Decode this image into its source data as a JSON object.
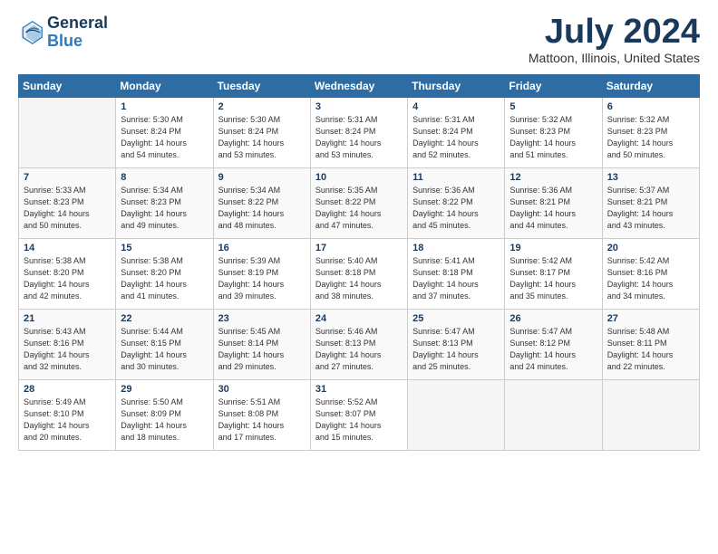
{
  "logo": {
    "line1": "General",
    "line2": "Blue"
  },
  "title": "July 2024",
  "location": "Mattoon, Illinois, United States",
  "days_of_week": [
    "Sunday",
    "Monday",
    "Tuesday",
    "Wednesday",
    "Thursday",
    "Friday",
    "Saturday"
  ],
  "weeks": [
    [
      {
        "num": "",
        "info": ""
      },
      {
        "num": "1",
        "info": "Sunrise: 5:30 AM\nSunset: 8:24 PM\nDaylight: 14 hours\nand 54 minutes."
      },
      {
        "num": "2",
        "info": "Sunrise: 5:30 AM\nSunset: 8:24 PM\nDaylight: 14 hours\nand 53 minutes."
      },
      {
        "num": "3",
        "info": "Sunrise: 5:31 AM\nSunset: 8:24 PM\nDaylight: 14 hours\nand 53 minutes."
      },
      {
        "num": "4",
        "info": "Sunrise: 5:31 AM\nSunset: 8:24 PM\nDaylight: 14 hours\nand 52 minutes."
      },
      {
        "num": "5",
        "info": "Sunrise: 5:32 AM\nSunset: 8:23 PM\nDaylight: 14 hours\nand 51 minutes."
      },
      {
        "num": "6",
        "info": "Sunrise: 5:32 AM\nSunset: 8:23 PM\nDaylight: 14 hours\nand 50 minutes."
      }
    ],
    [
      {
        "num": "7",
        "info": "Sunrise: 5:33 AM\nSunset: 8:23 PM\nDaylight: 14 hours\nand 50 minutes."
      },
      {
        "num": "8",
        "info": "Sunrise: 5:34 AM\nSunset: 8:23 PM\nDaylight: 14 hours\nand 49 minutes."
      },
      {
        "num": "9",
        "info": "Sunrise: 5:34 AM\nSunset: 8:22 PM\nDaylight: 14 hours\nand 48 minutes."
      },
      {
        "num": "10",
        "info": "Sunrise: 5:35 AM\nSunset: 8:22 PM\nDaylight: 14 hours\nand 47 minutes."
      },
      {
        "num": "11",
        "info": "Sunrise: 5:36 AM\nSunset: 8:22 PM\nDaylight: 14 hours\nand 45 minutes."
      },
      {
        "num": "12",
        "info": "Sunrise: 5:36 AM\nSunset: 8:21 PM\nDaylight: 14 hours\nand 44 minutes."
      },
      {
        "num": "13",
        "info": "Sunrise: 5:37 AM\nSunset: 8:21 PM\nDaylight: 14 hours\nand 43 minutes."
      }
    ],
    [
      {
        "num": "14",
        "info": "Sunrise: 5:38 AM\nSunset: 8:20 PM\nDaylight: 14 hours\nand 42 minutes."
      },
      {
        "num": "15",
        "info": "Sunrise: 5:38 AM\nSunset: 8:20 PM\nDaylight: 14 hours\nand 41 minutes."
      },
      {
        "num": "16",
        "info": "Sunrise: 5:39 AM\nSunset: 8:19 PM\nDaylight: 14 hours\nand 39 minutes."
      },
      {
        "num": "17",
        "info": "Sunrise: 5:40 AM\nSunset: 8:18 PM\nDaylight: 14 hours\nand 38 minutes."
      },
      {
        "num": "18",
        "info": "Sunrise: 5:41 AM\nSunset: 8:18 PM\nDaylight: 14 hours\nand 37 minutes."
      },
      {
        "num": "19",
        "info": "Sunrise: 5:42 AM\nSunset: 8:17 PM\nDaylight: 14 hours\nand 35 minutes."
      },
      {
        "num": "20",
        "info": "Sunrise: 5:42 AM\nSunset: 8:16 PM\nDaylight: 14 hours\nand 34 minutes."
      }
    ],
    [
      {
        "num": "21",
        "info": "Sunrise: 5:43 AM\nSunset: 8:16 PM\nDaylight: 14 hours\nand 32 minutes."
      },
      {
        "num": "22",
        "info": "Sunrise: 5:44 AM\nSunset: 8:15 PM\nDaylight: 14 hours\nand 30 minutes."
      },
      {
        "num": "23",
        "info": "Sunrise: 5:45 AM\nSunset: 8:14 PM\nDaylight: 14 hours\nand 29 minutes."
      },
      {
        "num": "24",
        "info": "Sunrise: 5:46 AM\nSunset: 8:13 PM\nDaylight: 14 hours\nand 27 minutes."
      },
      {
        "num": "25",
        "info": "Sunrise: 5:47 AM\nSunset: 8:13 PM\nDaylight: 14 hours\nand 25 minutes."
      },
      {
        "num": "26",
        "info": "Sunrise: 5:47 AM\nSunset: 8:12 PM\nDaylight: 14 hours\nand 24 minutes."
      },
      {
        "num": "27",
        "info": "Sunrise: 5:48 AM\nSunset: 8:11 PM\nDaylight: 14 hours\nand 22 minutes."
      }
    ],
    [
      {
        "num": "28",
        "info": "Sunrise: 5:49 AM\nSunset: 8:10 PM\nDaylight: 14 hours\nand 20 minutes."
      },
      {
        "num": "29",
        "info": "Sunrise: 5:50 AM\nSunset: 8:09 PM\nDaylight: 14 hours\nand 18 minutes."
      },
      {
        "num": "30",
        "info": "Sunrise: 5:51 AM\nSunset: 8:08 PM\nDaylight: 14 hours\nand 17 minutes."
      },
      {
        "num": "31",
        "info": "Sunrise: 5:52 AM\nSunset: 8:07 PM\nDaylight: 14 hours\nand 15 minutes."
      },
      {
        "num": "",
        "info": ""
      },
      {
        "num": "",
        "info": ""
      },
      {
        "num": "",
        "info": ""
      }
    ]
  ]
}
